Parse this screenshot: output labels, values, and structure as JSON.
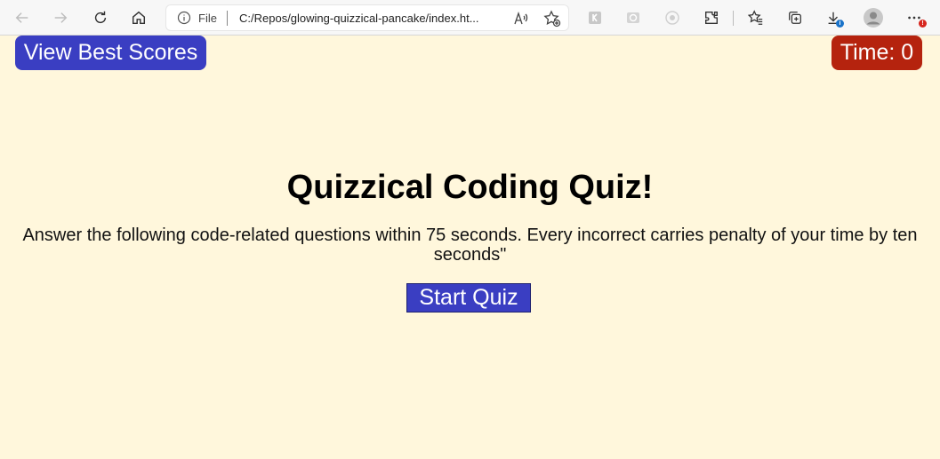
{
  "browser": {
    "file_label": "File",
    "url": "C:/Repos/glowing-quizzical-pancake/index.ht...",
    "download_badge": "i",
    "menu_badge": "!",
    "icons": [
      "back-icon",
      "forward-icon",
      "refresh-icon",
      "home-icon",
      "info-icon",
      "read-aloud-icon",
      "add-favorite-icon",
      "extension-1-icon",
      "extension-2-icon",
      "extension-3-icon",
      "extensions-icon",
      "favorites-icon",
      "collections-icon",
      "downloads-icon",
      "profile-icon",
      "more-icon"
    ]
  },
  "header": {
    "best_scores_label": "View Best Scores",
    "timer_label": "Time: 0"
  },
  "main": {
    "title": "Quizzical Coding Quiz!",
    "instructions": "Answer the following code-related questions within 75 seconds. Every incorrect carries penalty of your time by ten seconds\"",
    "start_label": "Start Quiz"
  },
  "colors": {
    "page_background": "#fff7dc",
    "primary_button": "#3a3ec2",
    "timer_background": "#b5230e"
  }
}
